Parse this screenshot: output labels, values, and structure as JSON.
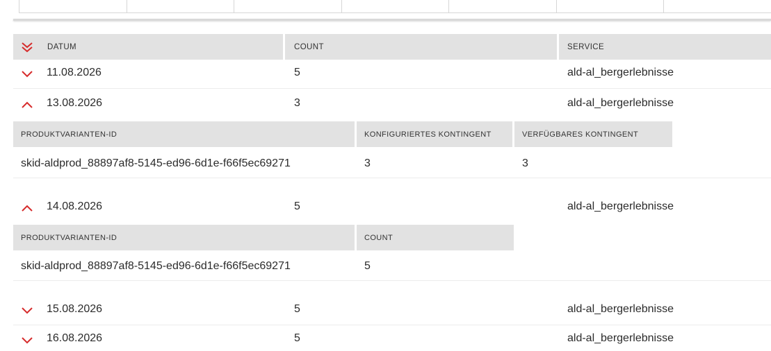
{
  "header": {
    "datum": "DATUM",
    "count": "COUNT",
    "service": "SERVICE"
  },
  "rows": [
    {
      "datum": "11.08.2026",
      "count": "5",
      "service": "ald-al_bergerlebnisse",
      "expanded": false
    },
    {
      "datum": "13.08.2026",
      "count": "3",
      "service": "ald-al_bergerlebnisse",
      "expanded": true
    },
    {
      "datum": "14.08.2026",
      "count": "5",
      "service": "ald-al_bergerlebnisse",
      "expanded": true
    },
    {
      "datum": "15.08.2026",
      "count": "5",
      "service": "ald-al_bergerlebnisse",
      "expanded": false
    },
    {
      "datum": "16.08.2026",
      "count": "5",
      "service": "ald-al_bergerlebnisse",
      "expanded": false
    }
  ],
  "detail_13": {
    "headers": [
      "PRODUKTVARIANTEN-ID",
      "KONFIGURIERTES KONTINGENT",
      "VERFÜGBARES KONTINGENT"
    ],
    "row": [
      "skid-aldprod_88897af8-5145-ed96-6d1e-f66f5ec69271",
      "3",
      "3"
    ]
  },
  "detail_14": {
    "headers": [
      "PRODUKTVARIANTEN-ID",
      "COUNT"
    ],
    "row": [
      "skid-aldprod_88897af8-5145-ed96-6d1e-f66f5ec69271",
      "5"
    ]
  },
  "icons": {
    "expand_all": "double-chevron-down-icon",
    "collapsed": "chevron-down-icon",
    "expanded": "chevron-up-icon"
  },
  "colors": {
    "accent": "#d62b2b",
    "header_bg": "#e2e2e2"
  }
}
